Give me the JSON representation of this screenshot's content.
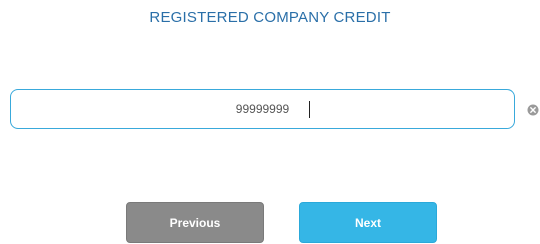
{
  "form": {
    "title": "REGISTERED COMPANY CREDIT",
    "field_value": "99999999",
    "field_placeholder": ""
  },
  "actions": {
    "previous_label": "Previous",
    "next_label": "Next"
  },
  "icons": {
    "clear": "close-circle-icon"
  },
  "colors": {
    "title": "#2a6fa8",
    "input_border": "#39a9db",
    "previous_button": "#8a8a8a",
    "next_button": "#35b6e6"
  }
}
